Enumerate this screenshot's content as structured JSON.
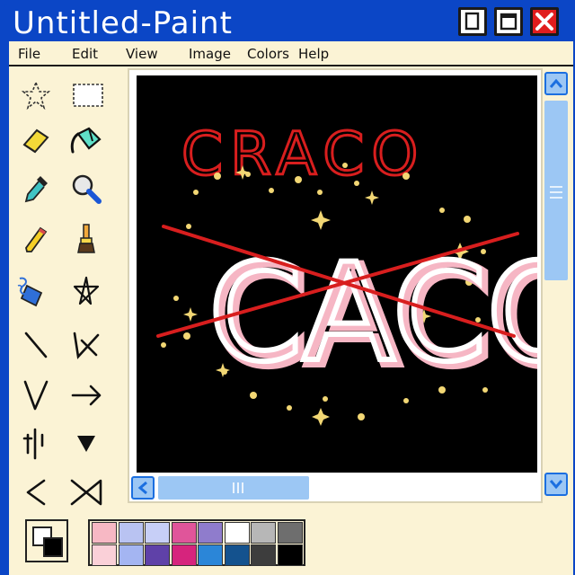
{
  "window": {
    "title": "Untitled-Paint"
  },
  "menu": [
    "File",
    "Edit",
    "View",
    "Image",
    "Colors",
    "Help"
  ],
  "tools": [
    "free-select-tool",
    "rect-select-tool",
    "eraser-tool",
    "fill-bucket-tool",
    "color-picker-tool",
    "magnifier-tool",
    "pencil-tool",
    "brush-tool",
    "airbrush-tool",
    "text-tool",
    "line-tool",
    "curve-tool",
    "rectangle-tool",
    "arrow-tool",
    "polygon-tool",
    "ellipse-tool",
    "rounded-rect-tool",
    "shape-tool"
  ],
  "canvas_art": {
    "scribble_text": "CRACO",
    "main_text": "CACO"
  },
  "colors": {
    "titlebar": "#0b46c6",
    "client_bg": "#fbf3d5",
    "scroll_accent": "#9cc7f4",
    "scroll_arrow": "#1b6fe0",
    "close_red": "#e11d1d",
    "strike_red": "#d81e1e",
    "art_pink": "#f6b6c4"
  },
  "palette": {
    "primary": "#ffffff",
    "secondary": "#000000",
    "swatches_top": [
      "#f7b8c4",
      "#b9c3f2",
      "#c7cff7",
      "#e0559a",
      "#8f7ccc",
      "#ffffff",
      "#b7b7b7",
      "#6e6e6e"
    ],
    "swatches_bottom": [
      "#fad0d8",
      "#a4b5f2",
      "#5f41a8",
      "#d6247d",
      "#2b86d8",
      "#14528e",
      "#3d3d3d",
      "#000000"
    ]
  }
}
